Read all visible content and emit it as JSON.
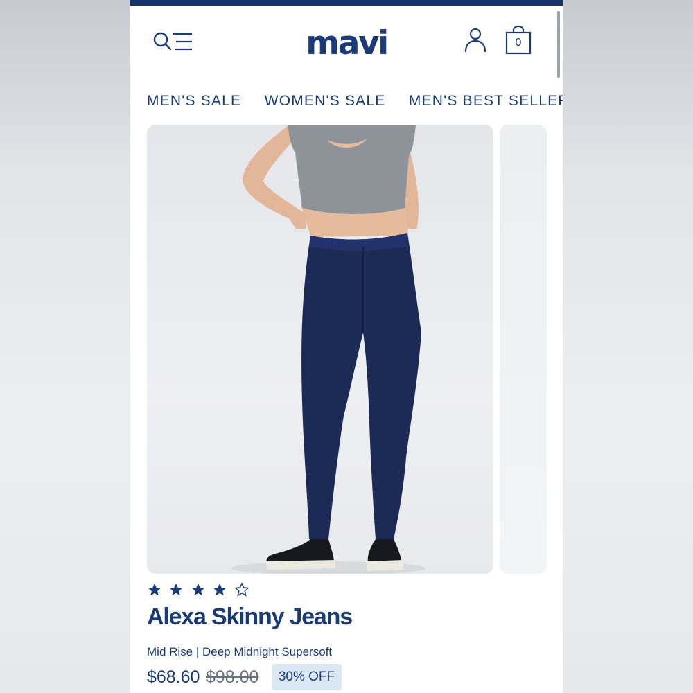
{
  "header": {
    "logo": "mavi",
    "cart_count": "0"
  },
  "nav": {
    "items": [
      "MEN'S SALE",
      "WOMEN'S SALE",
      "MEN'S BEST SELLERS"
    ]
  },
  "product": {
    "rating": 4,
    "rating_max": 5,
    "title": "Alexa Skinny Jeans",
    "subtitle": "Mid Rise | Deep Midnight Supersoft",
    "price": "$68.60",
    "original_price": "$98.00",
    "discount_badge": "30% OFF"
  },
  "icons": {
    "menu": "search-menu-icon",
    "account": "user-icon",
    "cart": "shopping-bag-icon",
    "star_filled": "star-filled-icon",
    "star_empty": "star-outline-icon"
  },
  "colors": {
    "brand": "#1b3a78",
    "top_bar": "#14336a",
    "badge_bg": "#dce7f4",
    "old_price": "#6b7280"
  }
}
